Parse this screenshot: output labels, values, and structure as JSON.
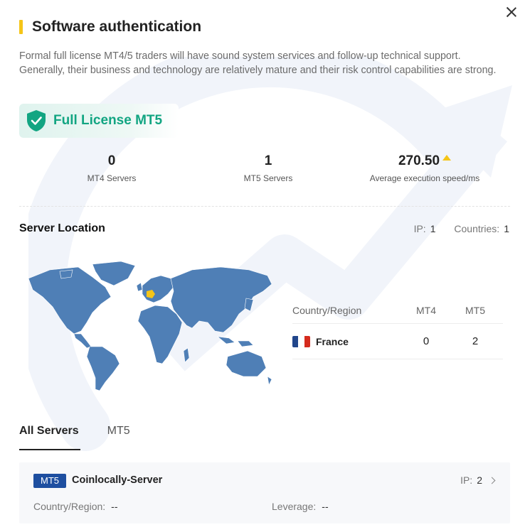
{
  "header": {
    "title": "Software authentication",
    "close_icon": "close-icon",
    "accent_color": "#f5c518"
  },
  "description": "Formal full license MT4/5 traders will have sound system services and follow-up technical support. Generally, their business and technology are relatively mature and their risk control capabilities are strong.",
  "license": {
    "label": "Full License MT5",
    "icon": "shield-check-icon",
    "color": "#12a582"
  },
  "stats": [
    {
      "value": "0",
      "label": "MT4 Servers"
    },
    {
      "value": "1",
      "label": "MT5 Servers"
    },
    {
      "value": "270.50",
      "label": "Average execution speed/ms",
      "icon": "arrow-up-icon"
    }
  ],
  "server_location": {
    "title": "Server Location",
    "ip_label": "IP:",
    "ip_value": "1",
    "countries_label": "Countries:",
    "countries_value": "1",
    "map_icon": "world-map",
    "table": {
      "headers": [
        "Country/Region",
        "MT4",
        "MT5"
      ],
      "rows": [
        {
          "country": "France",
          "flag": "flag-france-icon",
          "mt4": "0",
          "mt5": "2"
        }
      ]
    }
  },
  "tabs": [
    {
      "label": "All Servers",
      "active": true
    },
    {
      "label": "MT5",
      "active": false
    }
  ],
  "servers": [
    {
      "badge": "MT5",
      "name": "Coinlocally-Server",
      "ip_label": "IP:",
      "ip_value": "2",
      "country_label": "Country/Region:",
      "country_value": "--",
      "leverage_label": "Leverage:",
      "leverage_value": "--",
      "badge_color": "#1e4fa0"
    }
  ]
}
